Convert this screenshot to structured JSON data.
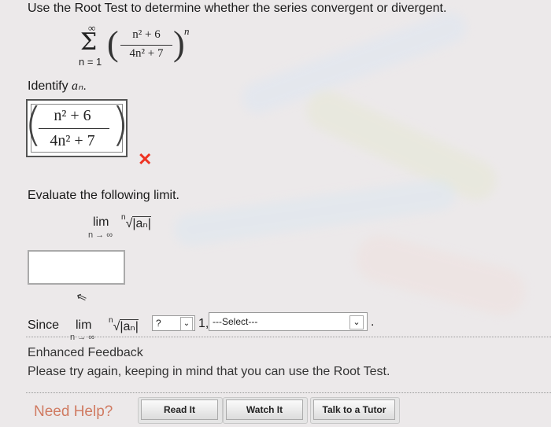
{
  "question": {
    "prompt": "Use the Root Test to determine whether the series convergent or divergent.",
    "series": {
      "upper": "∞",
      "lower": "n = 1",
      "numerator": "n² + 6",
      "denominator": "4n² + 7",
      "exponent": "n"
    }
  },
  "identify": {
    "label_prefix": "Identify ",
    "label_var": "aₙ",
    "label_suffix": ".",
    "answer_numerator": "n² + 6",
    "answer_denominator": "4n² + 7",
    "status_icon": "incorrect-x"
  },
  "evaluate": {
    "label": "Evaluate the following limit.",
    "lim": "lim",
    "sub": "n → ∞",
    "index": "n",
    "radicand": "|aₙ|",
    "input_value": ""
  },
  "since": {
    "label": "Since",
    "lim": "lim",
    "sub": "n → ∞",
    "index": "n",
    "radicand": "|aₙ|",
    "compare_value": "?",
    "one": "1,",
    "select_value": "---Select---",
    "period": "."
  },
  "feedback": {
    "title": "Enhanced Feedback",
    "message": "Please try again, keeping in mind that you can use the Root Test."
  },
  "help": {
    "label": "Need Help?",
    "buttons": [
      "Read It",
      "Watch It",
      "Talk to a Tutor"
    ]
  }
}
